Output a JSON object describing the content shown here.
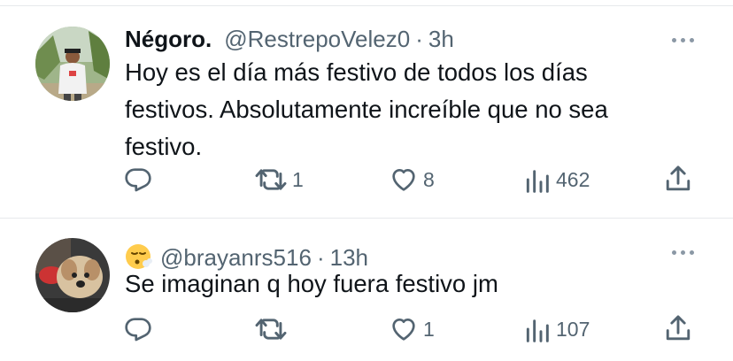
{
  "tweets": [
    {
      "name": "Négoro.",
      "handle": "@RestrepoVelez0",
      "separator": "·",
      "time": "3h",
      "text_lines": [
        "Hoy es el día más festivo de todos los días",
        "festivos. Absolutamente increíble que no sea",
        "festivo."
      ],
      "reply_count": "",
      "retweet_count": "1",
      "like_count": "8",
      "view_count": "462"
    },
    {
      "emoji": "😮‍💨",
      "handle": "@brayanrs516",
      "separator": "·",
      "time": "13h",
      "text_lines": [
        "Se imaginan q hoy fuera festivo jm"
      ],
      "reply_count": "",
      "retweet_count": "",
      "like_count": "1",
      "view_count": "107"
    }
  ],
  "icons": {
    "reply": "reply-icon",
    "retweet": "retweet-icon",
    "like": "heart-icon",
    "views": "views-icon",
    "share": "share-icon",
    "more": "more-icon"
  },
  "colors": {
    "text": "#0f1419",
    "secondary": "#536471",
    "divider": "#e6e9eb"
  }
}
